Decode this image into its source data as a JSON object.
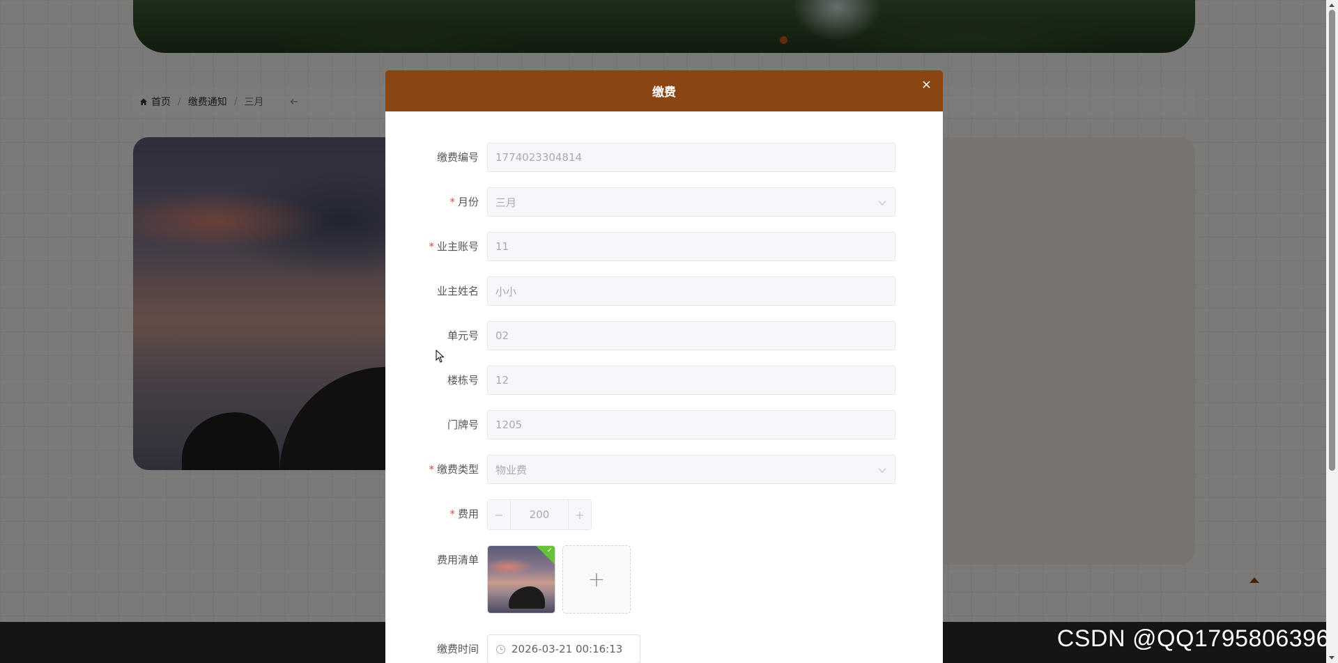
{
  "breadcrumb": {
    "home": "首页",
    "section": "缴费通知",
    "current": "三月",
    "separator": "/",
    "back_icon": "back-arrow-icon"
  },
  "dialog": {
    "title": "缴费",
    "close_icon": "×",
    "header_color": "#8b4513"
  },
  "form": {
    "payment_no": {
      "label": "缴费编号",
      "value": "1774023304814",
      "required": false
    },
    "month": {
      "label": "月份",
      "value": "三月",
      "required": true
    },
    "owner_account": {
      "label": "业主账号",
      "value": "11",
      "required": true
    },
    "owner_name": {
      "label": "业主姓名",
      "value": "小小",
      "required": false
    },
    "unit_no": {
      "label": "单元号",
      "value": "02",
      "required": false
    },
    "building_no": {
      "label": "楼栋号",
      "value": "12",
      "required": false
    },
    "door_no": {
      "label": "门牌号",
      "value": "1205",
      "required": false
    },
    "fee_type": {
      "label": "缴费类型",
      "value": "物业费",
      "required": true
    },
    "amount": {
      "label": "费用",
      "value": "200",
      "minus": "−",
      "plus": "+",
      "required": true
    },
    "fee_list": {
      "label": "费用清单",
      "check": "✓",
      "add": "+"
    },
    "pay_time": {
      "label": "缴费时间",
      "value": "2026-03-21 00:16:13"
    },
    "required_mark": "*"
  },
  "watermark": "CSDN @QQ1795806396",
  "colors": {
    "accent": "#8b4513",
    "success": "#67c23a",
    "required": "#e34a3a"
  }
}
